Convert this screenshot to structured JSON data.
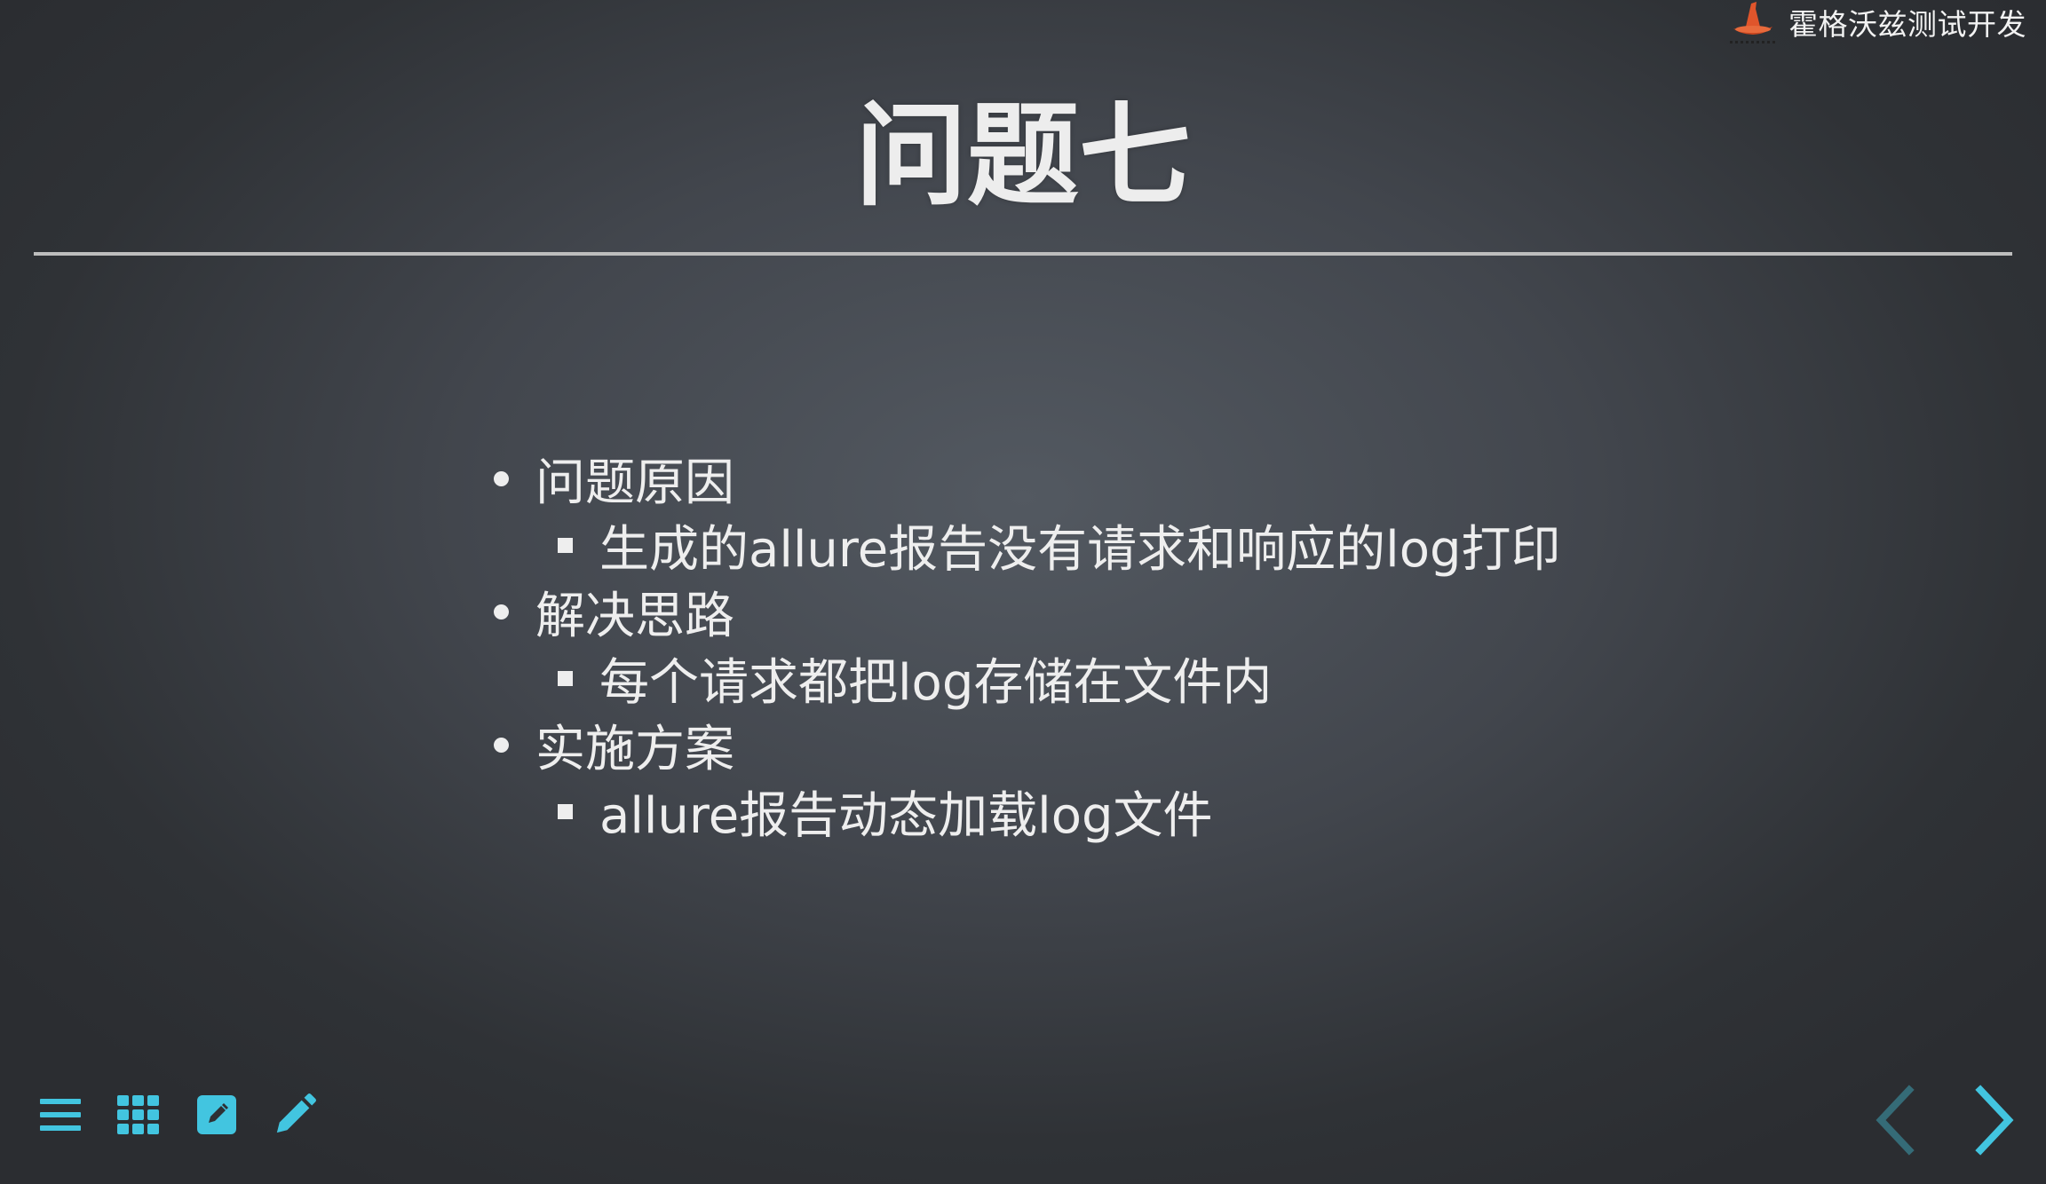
{
  "brand": {
    "name": "霍格沃兹测试开发"
  },
  "slide": {
    "title": "问题七",
    "items": [
      {
        "label": "问题原因",
        "sub": [
          "生成的allure报告没有请求和响应的log打印"
        ]
      },
      {
        "label": "解决思路",
        "sub": [
          "每个请求都把log存储在文件内"
        ]
      },
      {
        "label": "实施方案",
        "sub": [
          "allure报告动态加载log文件"
        ]
      }
    ]
  },
  "toolbar": {
    "icons": [
      "menu-icon",
      "grid-icon",
      "edit-note-icon",
      "pencil-icon"
    ]
  },
  "nav": {
    "prev_icon": "chevron-left-icon",
    "next_icon": "chevron-right-icon"
  },
  "colors": {
    "accent": "#42c5e0",
    "accent_dim": "#356b77",
    "text": "#eeeeee",
    "rule": "#bdbdbd",
    "logo": "#e0552b"
  }
}
